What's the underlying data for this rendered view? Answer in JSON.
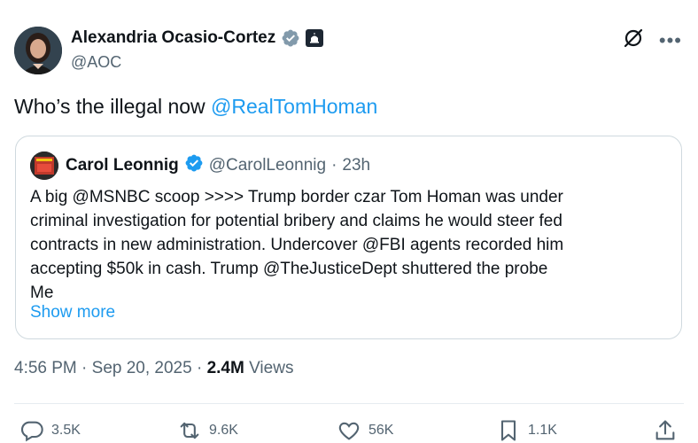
{
  "author": {
    "name": "Alexandria Ocasio-Cortez",
    "handle": "@AOC",
    "verified_color": "#829aab"
  },
  "tweet": {
    "text_prefix": "Who’s the illegal now ",
    "mention": "@RealTomHoman"
  },
  "quote": {
    "name": "Carol Leonnig",
    "handle": "@CarolLeonnig",
    "separator": "·",
    "time": "23h",
    "lines": [
      "A big @MSNBC scoop >>>>  Trump border czar Tom Homan was under",
      "criminal investigation for potential bribery and claims he would steer fed",
      "contracts in new administration.  Undercover @FBI agents recorded him",
      "accepting $50k in cash. Trump @TheJusticeDept shuttered the probe",
      "Me"
    ],
    "show_more": "Show more"
  },
  "meta": {
    "time_date": "4:56 PM · Sep 20, 2025 · ",
    "views_count": "2.4M",
    "views_label": " Views"
  },
  "actions": {
    "replies": "3.5K",
    "reposts": "9.6K",
    "likes": "56K",
    "bookmarks": "1.1K"
  },
  "icons": [
    "verified-badge-icon",
    "government-badge-icon",
    "grok-icon",
    "more-icon",
    "reply-icon",
    "repost-icon",
    "like-icon",
    "bookmark-icon",
    "share-icon"
  ],
  "colors": {
    "link": "#1d9bf0",
    "secondary_text": "#536471",
    "primary_text": "#0f1419",
    "border": "#cfd9de"
  }
}
